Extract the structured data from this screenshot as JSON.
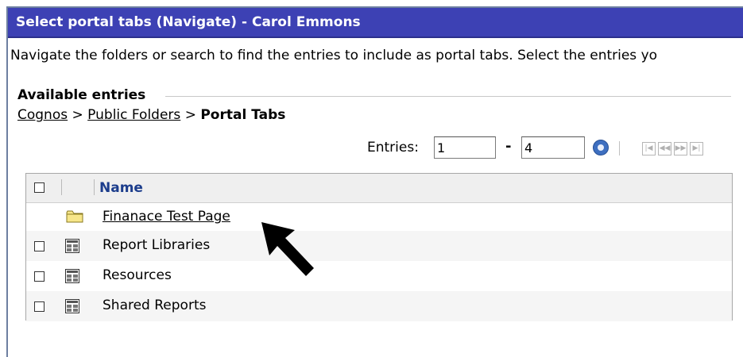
{
  "window": {
    "title": "Select portal tabs (Navigate) - Carol Emmons"
  },
  "instructions": "Navigate the folders or search to find the entries to include as portal tabs. Select the entries yo",
  "section_title": "Available entries",
  "breadcrumb": {
    "items": [
      "Cognos",
      "Public Folders"
    ],
    "separator": ">",
    "current": "Portal Tabs"
  },
  "pager": {
    "entries_label": "Entries:",
    "from": "1",
    "to": "4",
    "dash": "-",
    "first_glyph": "|◀",
    "prev_glyph": "◀◀",
    "next_glyph": "▶▶",
    "last_glyph": "▶|"
  },
  "table": {
    "header": {
      "name": "Name"
    },
    "rows": [
      {
        "name": "Finanace Test Page",
        "type": "folder",
        "checkbox": false,
        "link": true
      },
      {
        "name": "Report Libraries",
        "type": "page",
        "checkbox": true,
        "link": false
      },
      {
        "name": "Resources",
        "type": "page",
        "checkbox": true,
        "link": false
      },
      {
        "name": "Shared Reports",
        "type": "page",
        "checkbox": true,
        "link": false
      }
    ]
  },
  "icons": {
    "folder": "folder-icon",
    "page": "portal-page-icon",
    "go": "go-icon",
    "cursor": "arrow-pointer-icon"
  },
  "colors": {
    "title_bar": "#3d41b4",
    "header_text": "#1c3d8c",
    "folder_fill": "#f7e68a"
  }
}
